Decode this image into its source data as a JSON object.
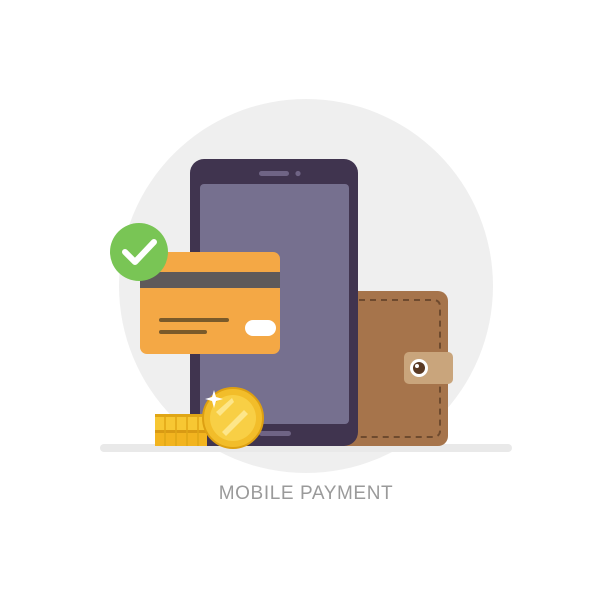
{
  "caption": "MOBILE PAYMENT",
  "icons": [
    "check-icon",
    "smartphone-icon",
    "credit-card-icon",
    "wallet-icon",
    "coin-stack-icon",
    "gold-coin-icon",
    "sparkle-icon"
  ],
  "colors": {
    "background_circle": "#efefef",
    "phone_body": "#40344f",
    "phone_screen": "#76708f",
    "card": "#f4a845",
    "card_stripe": "#5e5a5a",
    "wallet": "#a6744b",
    "wallet_clasp": "#c9a57c",
    "check_badge": "#79c555",
    "coin": "#f2bd2a",
    "caption": "#9a9a9a"
  }
}
